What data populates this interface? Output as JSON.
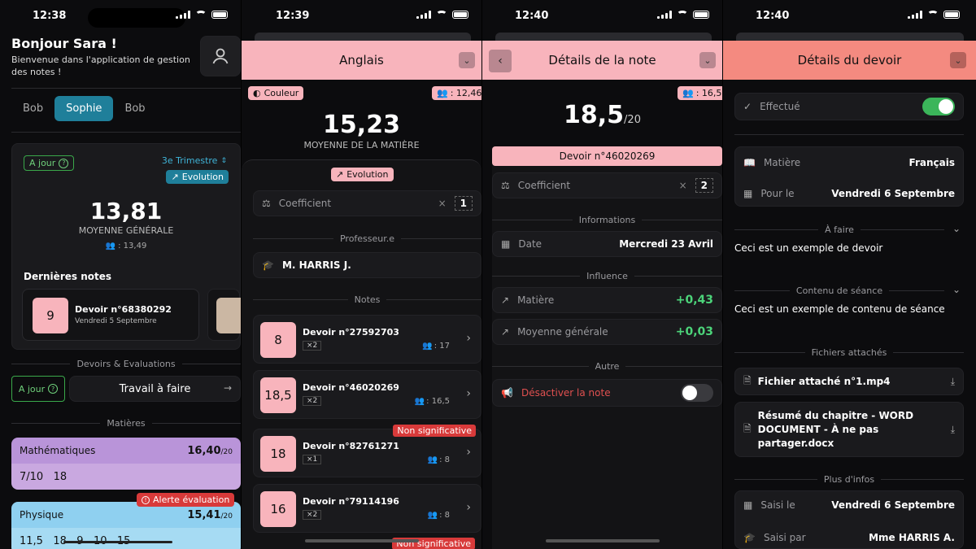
{
  "screens": [
    {
      "time": "12:38"
    },
    {
      "time": "12:39"
    },
    {
      "time": "12:40"
    },
    {
      "time": "12:40"
    }
  ],
  "home": {
    "greeting": "Bonjour Sara !",
    "welcome": "Bienvenue dans l'application de gestion des notes !",
    "tabs": [
      "Bob",
      "Sophie",
      "Bob"
    ],
    "status_badge": "A jour",
    "trimester": "3e Trimestre",
    "evolution": "Evolution",
    "average": "13,81",
    "average_label": "MOYENNE GÉNÉRALE",
    "class_avg": ": 13,49",
    "last_grades_title": "Dernières notes",
    "last_grade": {
      "value": "9",
      "title": "Devoir n°68380292",
      "date": "Vendredi 5 Septembre"
    },
    "homework_section": "Devoirs & Evaluations",
    "homework_badge": "A jour",
    "homework_button": "Travail à faire",
    "subjects_section": "Matières",
    "subjects": [
      {
        "name": "Mathématiques",
        "avg": "16,40",
        "den": "/20",
        "grades": "7/10   18",
        "color": "#b994d9",
        "grades_bg": "#c9a8e0"
      },
      {
        "name": "Physique",
        "avg": "15,41",
        "den": "/20",
        "grades": "11,5   18   9   10   15",
        "color": "#8fd0f0",
        "grades_bg": "#a6dbf3"
      }
    ],
    "alert": "Alerte évaluation"
  },
  "subject": {
    "title": "Anglais",
    "color_btn": "Couleur",
    "class_count": ": 12,46",
    "average": "15,23",
    "average_label": "MOYENNE DE LA MATIÈRE",
    "evolution": "Evolution",
    "coef_label": "Coefficient",
    "coef_value": "1",
    "prof_section": "Professeur.e",
    "prof_name": "M. HARRIS J.",
    "notes_section": "Notes",
    "non_sig": "Non significative",
    "notes": [
      {
        "value": "8",
        "title": "Devoir n°27592703",
        "coef": "×2",
        "cls": ": 17"
      },
      {
        "value": "18,5",
        "title": "Devoir n°46020269",
        "coef": "×2",
        "cls": ": 16,5"
      },
      {
        "value": "18",
        "title": "Devoir n°82761271",
        "coef": "×1",
        "cls": ": 8"
      },
      {
        "value": "16",
        "title": "Devoir n°79114196",
        "coef": "×2",
        "cls": ": 8"
      }
    ]
  },
  "grade": {
    "title": "Détails de la note",
    "class_count": ": 16,5",
    "value": "18,5",
    "den": "/20",
    "homework": "Devoir n°46020269",
    "coef_label": "Coefficient",
    "coef_value": "2",
    "info_section": "Informations",
    "date_label": "Date",
    "date_value": "Mercredi 23 Avril",
    "influence_section": "Influence",
    "subject_label": "Matière",
    "subject_value": "+0,43",
    "general_label": "Moyenne générale",
    "general_value": "+0,03",
    "other_section": "Autre",
    "disable_label": "Désactiver la note"
  },
  "homework": {
    "title": "Détails du devoir",
    "done_label": "Effectué",
    "subject_label": "Matière",
    "subject_value": "Français",
    "due_label": "Pour le",
    "due_value": "Vendredi 6 Septembre",
    "todo_section": "À faire",
    "todo_text": "Ceci est un exemple de devoir",
    "content_section": "Contenu de séance",
    "content_text": "Ceci est un exemple de contenu de séance",
    "files_section": "Fichiers attachés",
    "files": [
      "Fichier attaché n°1.mp4",
      "Résumé du chapitre - WORD DOCUMENT - À ne pas partager.docx"
    ],
    "more_section": "Plus d'infos",
    "entered_label": "Saisi le",
    "entered_value": "Vendredi 6 Septembre",
    "by_label": "Saisi par",
    "by_value": "Mme HARRIS A."
  },
  "colors": {
    "accent_pink": "#f8b4bc",
    "accent_coral": "#f48a80",
    "teal": "#1f7f9a",
    "green": "#4cd47a",
    "red": "#e05050"
  }
}
